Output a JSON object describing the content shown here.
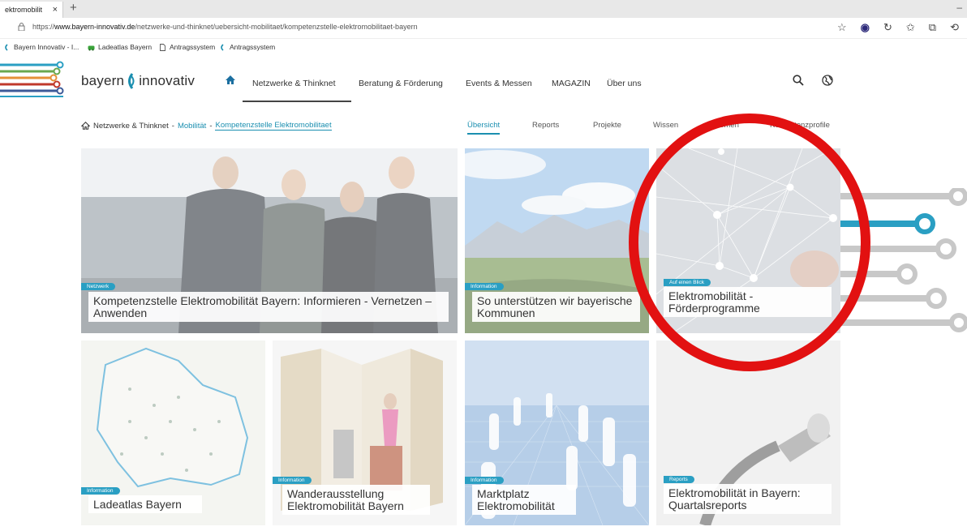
{
  "browser": {
    "tab_title": "ektromobilit",
    "tab_close": "×",
    "new_tab": "+",
    "minimize": "–",
    "url_prefix": "https://",
    "url_host": "www.bayern-innovativ.de",
    "url_path": "/netzwerke-und-thinknet/uebersicht-mobilitaet/kompetenzstelle-elektromobilitaet-bayern",
    "bookmarks": [
      {
        "label": "Bayern Innovativ - I...",
        "icon": "bayern-innovativ-icon"
      },
      {
        "label": "Ladeatlas Bayern",
        "icon": "car-icon"
      },
      {
        "label": "Antragssystem",
        "icon": "page-icon"
      },
      {
        "label": "Antragssystem",
        "icon": "bayern-innovativ-icon"
      }
    ]
  },
  "site": {
    "logo_left": "bayern",
    "logo_right": "innovativ",
    "nav": [
      {
        "label": "Netzwerke & Thinknet",
        "active": true
      },
      {
        "label": "Beratung & Förderung",
        "active": false
      },
      {
        "label": "Events & Messen",
        "active": false
      },
      {
        "label": "MAGAZIN",
        "active": false
      },
      {
        "label": "Über uns",
        "active": false
      }
    ],
    "breadcrumb": {
      "root": "Netzwerke & Thinknet",
      "sep1": "-",
      "level2": "Mobilität",
      "sep2": "-",
      "current": "Kompetenzstelle Elektromobilitaet"
    },
    "subnav": [
      {
        "label": "Übersicht",
        "active": true
      },
      {
        "label": "Reports",
        "active": false
      },
      {
        "label": "Projekte",
        "active": false
      },
      {
        "label": "Wissen",
        "active": false
      },
      {
        "label": "Themen",
        "active": false
      },
      {
        "label": "Kompetenzprofile",
        "active": false
      }
    ],
    "tiles": [
      {
        "badge": "Netzwerk",
        "caption": "Kompetenzstelle Elektromobilität Bayern: Informieren - Vernetzen – Anwenden"
      },
      {
        "badge": "Information",
        "caption": "So unterstützen wir bayerische Kommunen"
      },
      {
        "badge": "Auf einen Blick",
        "caption": "Elektromobilität - Förderprogramme"
      },
      {
        "badge": "Information",
        "caption": "Ladeatlas Bayern"
      },
      {
        "badge": "Information",
        "caption": "Wanderausstellung Elektromobilität Bayern"
      },
      {
        "badge": "Information",
        "caption": "Marktplatz Elektromobilität"
      },
      {
        "badge": "Reports",
        "caption": "Elektromobilität in Bayern: Quartalsreports"
      }
    ]
  },
  "colors": {
    "accent": "#1b8fb0",
    "badge": "#2a9fc3",
    "highlight": "#e21111"
  }
}
